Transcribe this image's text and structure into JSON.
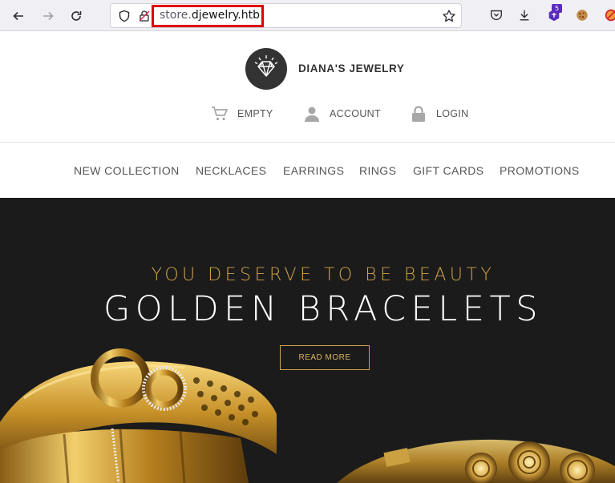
{
  "browser": {
    "url_prefix": "store.",
    "url_host": "djewelry.htb",
    "extension_badge": "5",
    "icons": [
      "back-icon",
      "forward-icon",
      "reload-icon",
      "shield-icon",
      "insecure-lock-icon",
      "bookmark-star-icon",
      "pocket-icon",
      "download-icon",
      "extension-icon",
      "cookie-icon",
      "blocked-icon"
    ]
  },
  "site": {
    "brand": "DIANA'S JEWELRY",
    "account_bar": {
      "cart_label": "EMPTY",
      "account_label": "ACCOUNT",
      "login_label": "LOGIN"
    },
    "nav": [
      "NEW COLLECTION",
      "NECKLACES",
      "EARRINGS",
      "RINGS",
      "GIFT CARDS",
      "PROMOTIONS"
    ],
    "hero": {
      "subtitle": "YOU DESERVE TO BE BEAUTY",
      "title": "GOLDEN BRACELETS",
      "button": "READ MORE"
    }
  },
  "colors": {
    "accent_gold": "#cfa24a",
    "hero_bg": "#1b1b1b",
    "highlight_red": "#e00000"
  }
}
